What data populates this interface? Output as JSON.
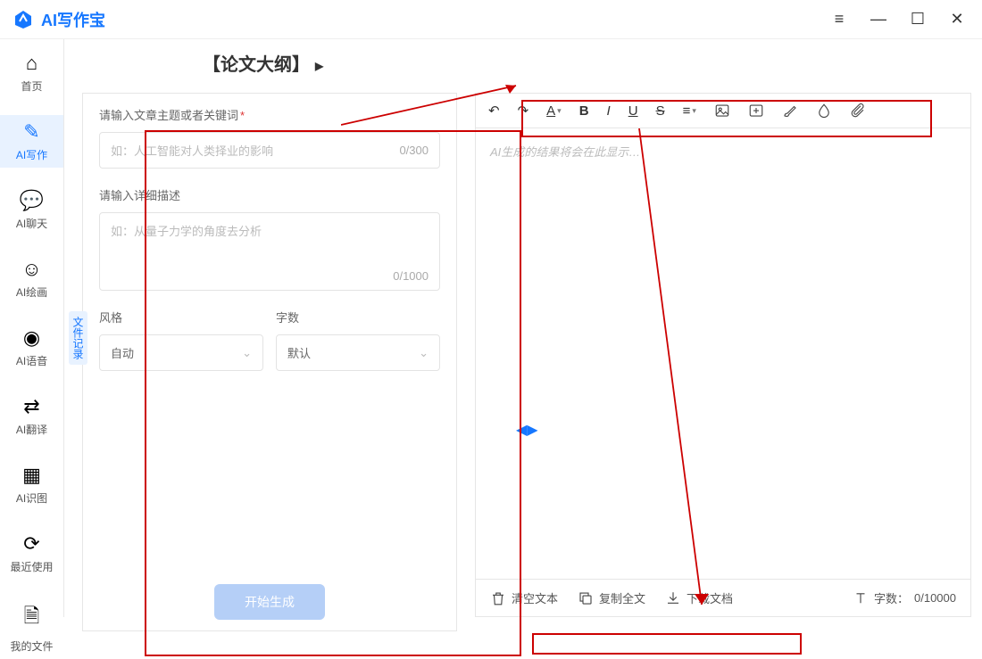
{
  "app": {
    "name": "AI写作宝"
  },
  "window": {
    "min": "—",
    "max": "☐",
    "close": "✕",
    "menu": "≡"
  },
  "sidebar": {
    "items": [
      {
        "label": "首页",
        "icon": "⌂"
      },
      {
        "label": "AI写作",
        "icon": "✎"
      },
      {
        "label": "AI聊天",
        "icon": "💬"
      },
      {
        "label": "AI绘画",
        "icon": "☺"
      },
      {
        "label": "AI语音",
        "icon": "◉"
      },
      {
        "label": "AI翻译",
        "icon": "⇄"
      },
      {
        "label": "AI识图",
        "icon": "▦"
      },
      {
        "label": "最近使用",
        "icon": "⟳"
      },
      {
        "label": "我的文件",
        "icon": "🗎"
      }
    ]
  },
  "page": {
    "title": "【论文大纲】"
  },
  "form": {
    "topic_label": "请输入文章主题或者关键词",
    "topic_placeholder": "如：人工智能对人类择业的影响",
    "topic_counter": "0/300",
    "detail_label": "请输入详细描述",
    "detail_placeholder": "如：从量子力学的角度去分析",
    "detail_counter": "0/1000",
    "style_label": "风格",
    "style_value": "自动",
    "length_label": "字数",
    "length_value": "默认",
    "pill": "文件记录",
    "generate": "开始生成"
  },
  "editor": {
    "placeholder": "AI生成的结果将会在此显示…"
  },
  "bottom": {
    "clear": "清空文本",
    "copy": "复制全文",
    "download": "下载文档",
    "wc_label": "字数：",
    "wc_value": "0/10000"
  }
}
